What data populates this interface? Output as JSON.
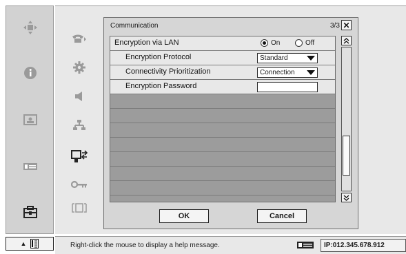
{
  "dialog": {
    "title": "Communication",
    "page": "3/3",
    "close_label": "✕"
  },
  "rows": [
    {
      "label": "Encryption via LAN",
      "radio_on": "On",
      "radio_off": "Off",
      "selected": "On"
    },
    {
      "label": "Encryption Protocol",
      "select_value": "Standard"
    },
    {
      "label": "Connectivity Prioritization",
      "select_value": "Connection"
    },
    {
      "label": "Encryption Password",
      "input_value": ""
    }
  ],
  "buttons": {
    "ok": "OK",
    "cancel": "Cancel"
  },
  "status": {
    "message": "Right-click the mouse to display a help message.",
    "ip": "IP:012.345.678.912"
  },
  "scroll_position": 0.85,
  "colors": {
    "dialog_bg": "#d6d6d6",
    "empty_row": "#9c9c9c",
    "active_row": "#e8e8e8"
  },
  "icons": {
    "primary": [
      "move-icon",
      "info-icon",
      "image-icon",
      "projector-icon",
      "setup-icon"
    ],
    "secondary": [
      "phone-icon",
      "gear-icon",
      "speaker-icon",
      "network-icon",
      "monitor-network-icon",
      "key-icon",
      "frame-icon"
    ]
  }
}
